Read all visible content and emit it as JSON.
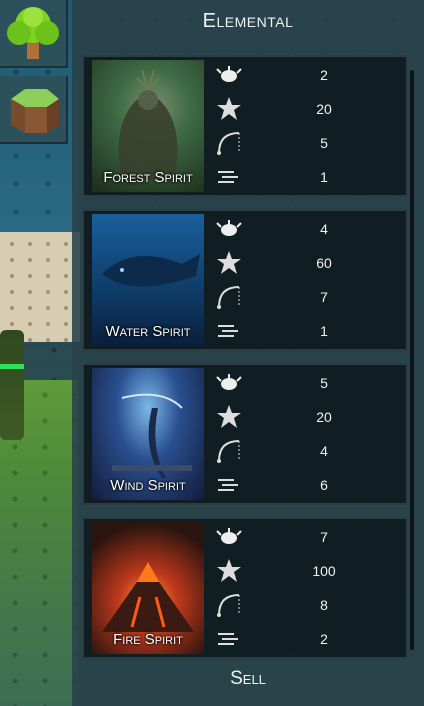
{
  "panel": {
    "title": "Elemental",
    "sell_label": "Sell"
  },
  "side_buttons": [
    {
      "name": "tree-tool-icon",
      "color": "#5fbf2a"
    },
    {
      "name": "hex-tile-tool-icon",
      "color": "#6aa84f"
    }
  ],
  "cards": [
    {
      "name": "Forest Spirit",
      "stats": [
        "2",
        "20",
        "5",
        "1"
      ],
      "colors": [
        "#3e6b45",
        "#1d2c1b",
        "#7a8f6a"
      ]
    },
    {
      "name": "Water Spirit",
      "stats": [
        "4",
        "60",
        "7",
        "1"
      ],
      "colors": [
        "#1a5f9c",
        "#0a1f3d",
        "#3c8fd1"
      ]
    },
    {
      "name": "Wind Spirit",
      "stats": [
        "5",
        "20",
        "4",
        "6"
      ],
      "colors": [
        "#2a4f8f",
        "#121c3b",
        "#7bb8e8"
      ]
    },
    {
      "name": "Fire Spirit",
      "stats": [
        "7",
        "100",
        "8",
        "2"
      ],
      "colors": [
        "#c0391b",
        "#2a1410",
        "#f2a13a"
      ]
    }
  ],
  "stat_icons": [
    "bug-icon",
    "damage-burst-icon",
    "range-icon",
    "speed-icon"
  ]
}
